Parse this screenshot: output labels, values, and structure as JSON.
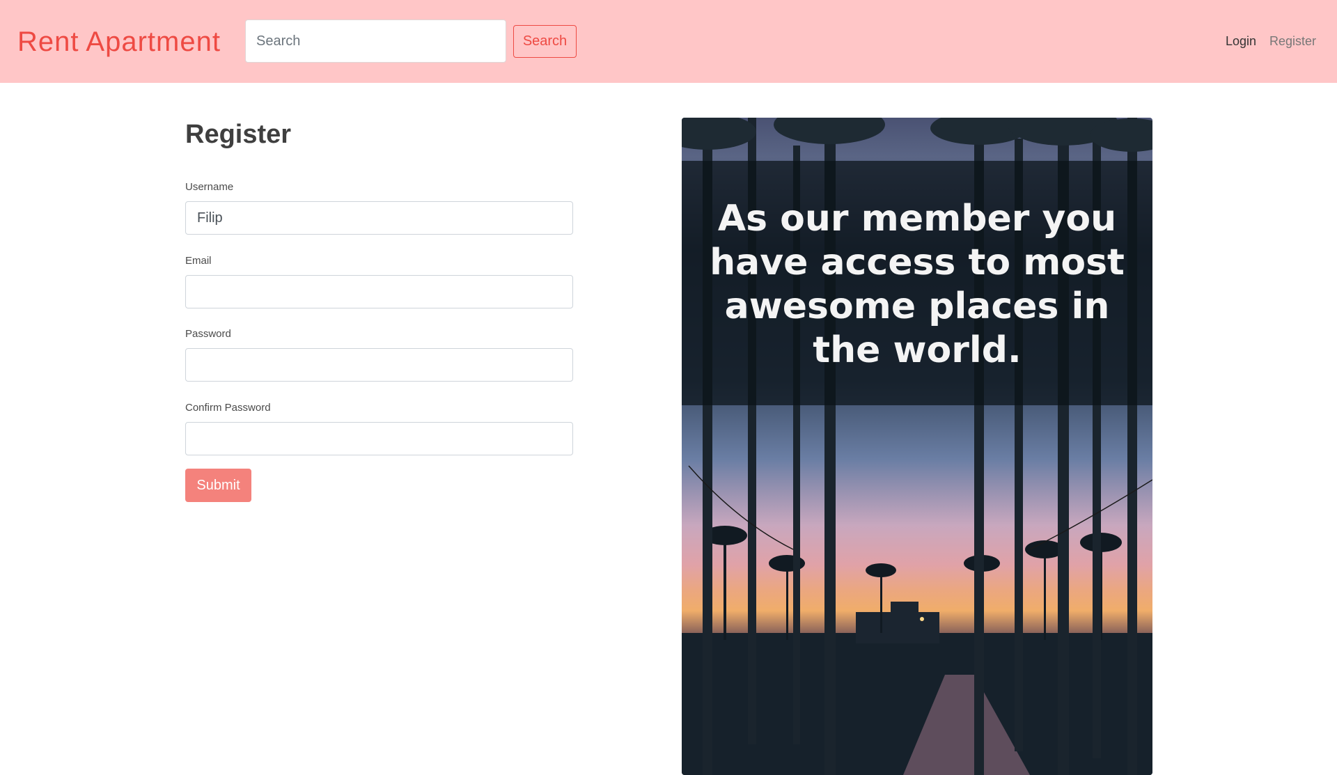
{
  "navbar": {
    "brand": "Rent Apartment",
    "search_placeholder": "Search",
    "search_button": "Search",
    "links": {
      "login": "Login",
      "register": "Register"
    }
  },
  "form": {
    "title": "Register",
    "fields": {
      "username": {
        "label": "Username",
        "value": "Filip"
      },
      "email": {
        "label": "Email",
        "value": ""
      },
      "password": {
        "label": "Password",
        "value": ""
      },
      "confirm_password": {
        "label": "Confirm Password",
        "value": ""
      }
    },
    "submit": "Submit"
  },
  "promo": {
    "text": "As our member you have access to most awesome places in the world."
  },
  "colors": {
    "navbar_bg": "#ffc6c7",
    "brand": "#ee4a43",
    "submit_bg": "#f4827c"
  }
}
